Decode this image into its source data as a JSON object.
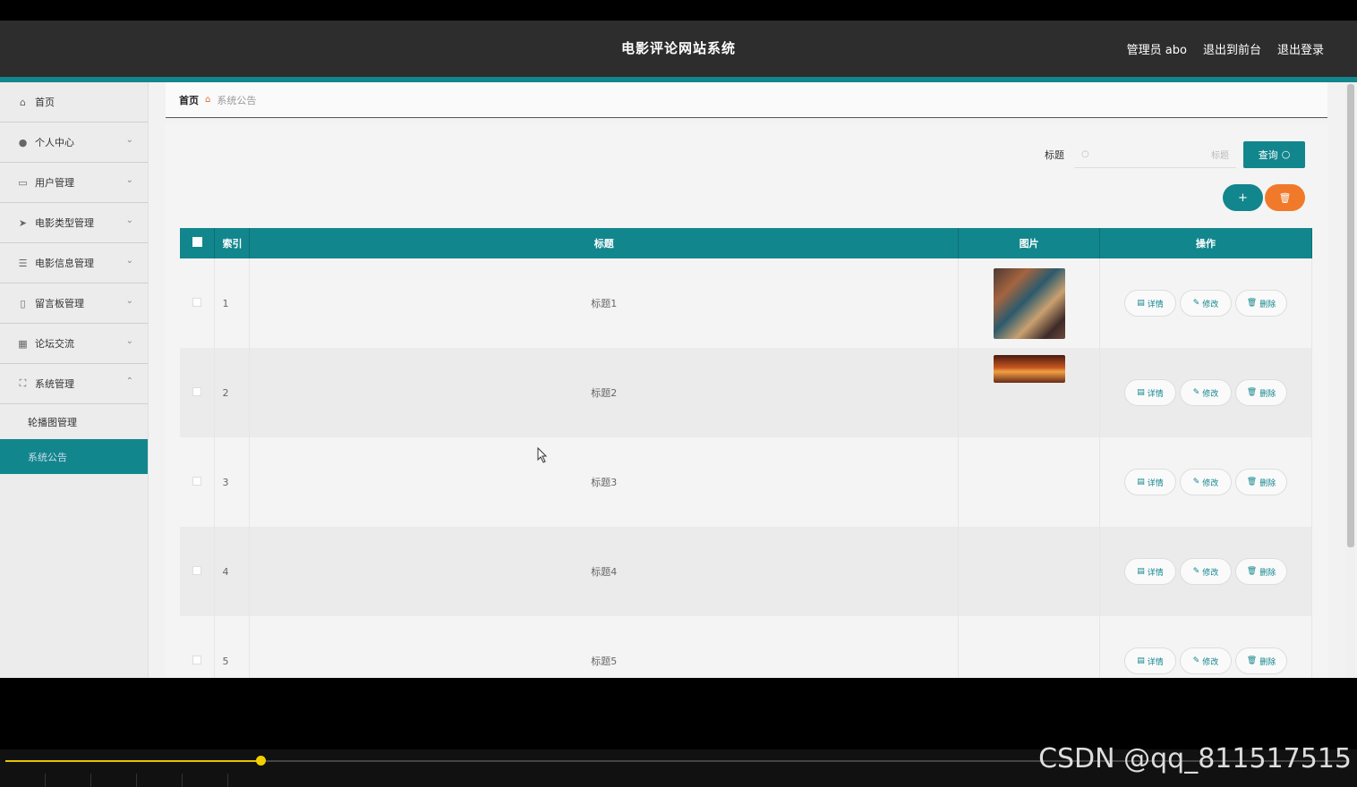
{
  "header": {
    "title": "电影评论网站系统",
    "user": "管理员 abo",
    "link_front": "退出到前台",
    "link_logout": "退出登录"
  },
  "sidebar": {
    "items": [
      {
        "label": "首页",
        "icon": "home-icon",
        "chevron": ""
      },
      {
        "label": "个人中心",
        "icon": "user-icon",
        "chevron": "⌄"
      },
      {
        "label": "用户管理",
        "icon": "chat-icon",
        "chevron": "⌄"
      },
      {
        "label": "电影类型管理",
        "icon": "send-icon",
        "chevron": "⌄"
      },
      {
        "label": "电影信息管理",
        "icon": "list-icon",
        "chevron": "⌄"
      },
      {
        "label": "留言板管理",
        "icon": "phone-icon",
        "chevron": "⌄"
      },
      {
        "label": "论坛交流",
        "icon": "grid-icon",
        "chevron": "⌄"
      },
      {
        "label": "系统管理",
        "icon": "expand-icon",
        "chevron": "⌃"
      }
    ],
    "sub_items": [
      {
        "label": "轮播图管理"
      },
      {
        "label": "系统公告"
      }
    ]
  },
  "breadcrumb": {
    "home": "首页",
    "current": "系统公告"
  },
  "search": {
    "label": "标题",
    "placeholder": "标题",
    "button": "查询"
  },
  "table": {
    "headers": [
      "索引",
      "标题",
      "图片",
      "操作"
    ],
    "rows": [
      {
        "index": "1",
        "title": "标题1"
      },
      {
        "index": "2",
        "title": "标题2"
      },
      {
        "index": "3",
        "title": "标题3"
      },
      {
        "index": "4",
        "title": "标题4"
      },
      {
        "index": "5",
        "title": "标题5"
      }
    ],
    "ops": {
      "detail": "详情",
      "edit": "修改",
      "delete": "删除"
    }
  },
  "colors": {
    "accent": "#12868d",
    "danger": "#f07a2a",
    "topbar": "#2d2d2d"
  },
  "video": {
    "progress": 0.19
  },
  "watermark": "CSDN @qq_811517515"
}
